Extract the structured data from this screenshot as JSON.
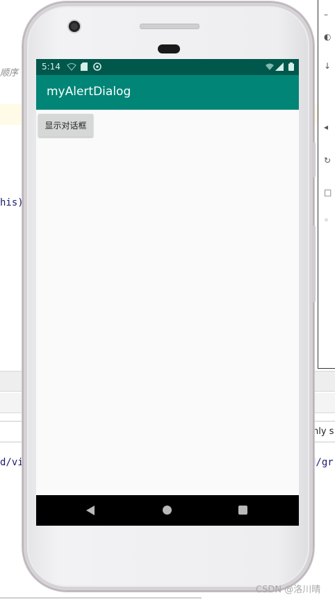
{
  "ide": {
    "comment_fragment": "顺序",
    "code_fragment_this": "his)",
    "code_fragment_left": "d/vi",
    "code_fragment_right": "d/gr",
    "right_text": "nly s"
  },
  "status_bar": {
    "time": "5:14"
  },
  "app_bar": {
    "title": "myAlertDialog"
  },
  "main": {
    "show_dialog_button_label": "显示对话框"
  },
  "watermark": "CSDN @洛川晴",
  "colors": {
    "status_bar": "#00574b",
    "app_bar": "#008577",
    "nav_bar": "#000000",
    "button": "#d6d7d7"
  }
}
